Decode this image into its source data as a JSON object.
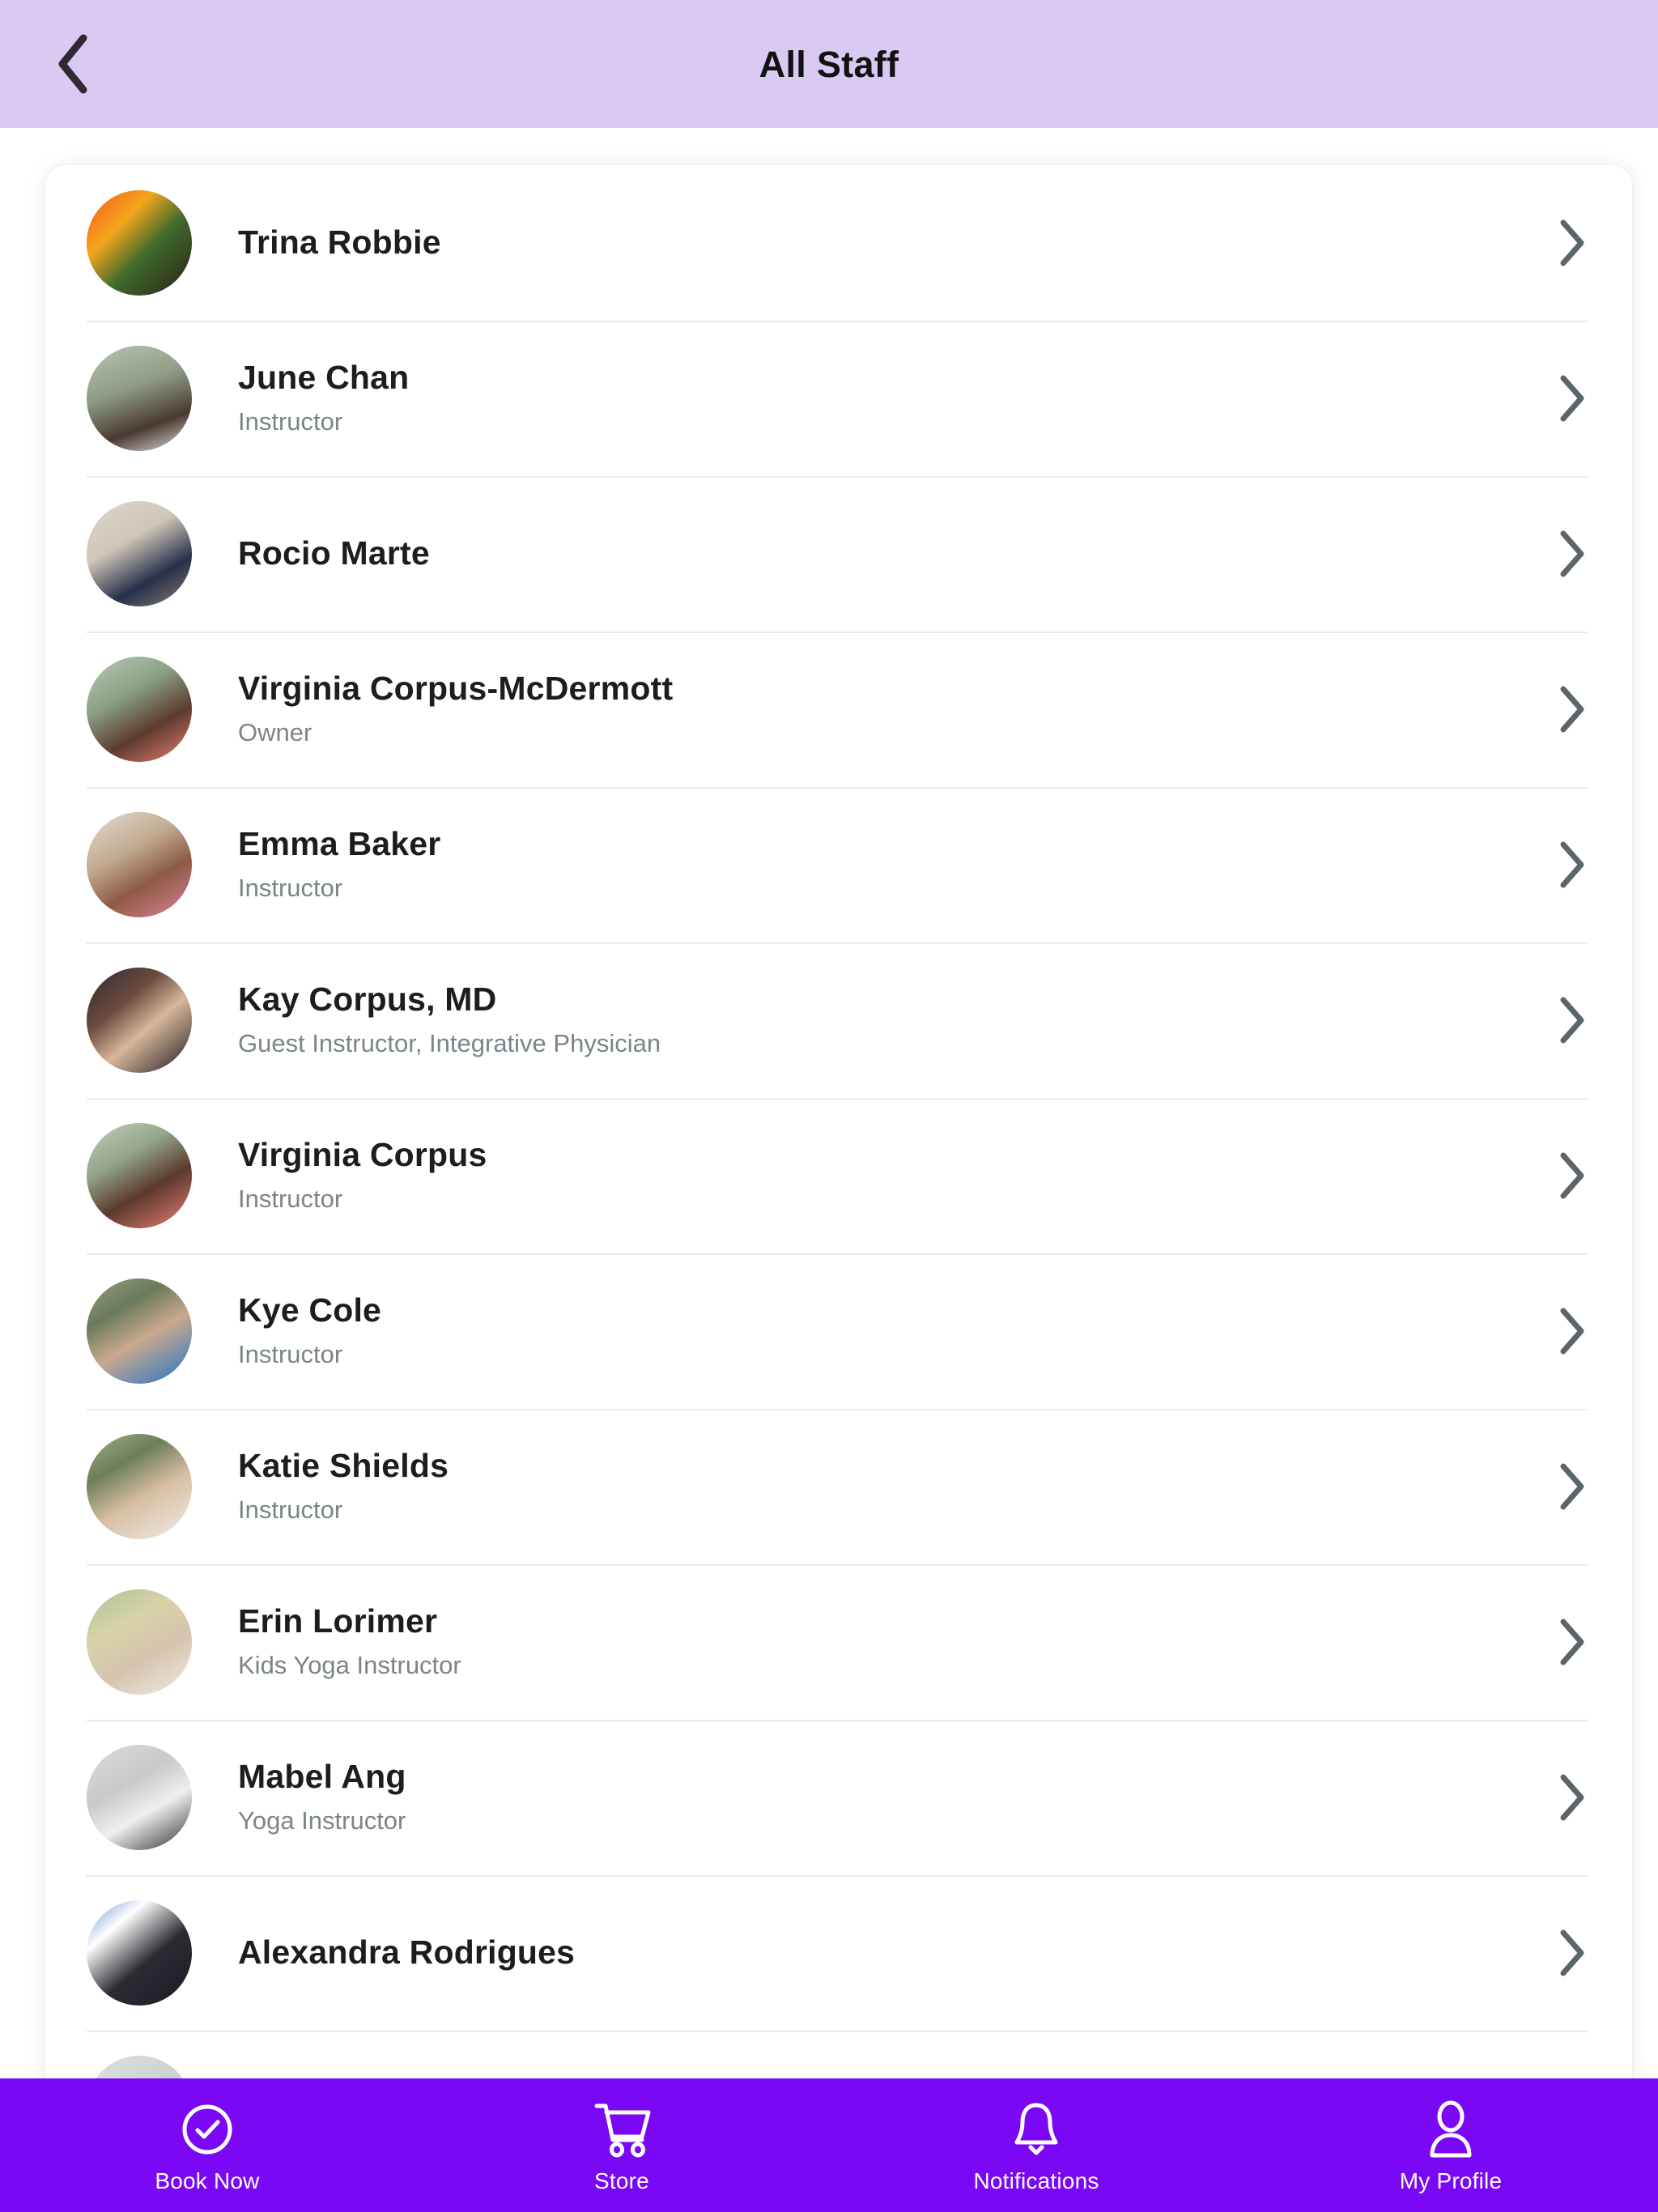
{
  "header": {
    "title": "All Staff",
    "back_icon": "chevron-left-icon",
    "background_color": "#dac9f2"
  },
  "staff_list": {
    "row_chevron_icon": "chevron-right-icon",
    "rows": [
      {
        "name": "Trina Robbie",
        "title": "",
        "avatar": "photo-trina-robbie"
      },
      {
        "name": "June Chan",
        "title": "Instructor",
        "avatar": "photo-june-chan"
      },
      {
        "name": "Rocio Marte",
        "title": "",
        "avatar": "photo-rocio-marte"
      },
      {
        "name": "Virginia Corpus-McDermott",
        "title": "Owner",
        "avatar": "photo-virginia-corpus-mcdermott"
      },
      {
        "name": "Emma Baker",
        "title": "Instructor",
        "avatar": "photo-emma-baker"
      },
      {
        "name": "Kay Corpus, MD",
        "title": "Guest Instructor, Integrative Physician",
        "avatar": "photo-kay-corpus"
      },
      {
        "name": "Virginia Corpus",
        "title": "Instructor",
        "avatar": "photo-virginia-corpus"
      },
      {
        "name": "Kye Cole",
        "title": "Instructor",
        "avatar": "photo-kye-cole"
      },
      {
        "name": "Katie Shields",
        "title": "Instructor",
        "avatar": "photo-katie-shields"
      },
      {
        "name": "Erin Lorimer",
        "title": "Kids Yoga Instructor",
        "avatar": "photo-erin-lorimer"
      },
      {
        "name": "Mabel Ang",
        "title": "Yoga Instructor",
        "avatar": "photo-mabel-ang"
      },
      {
        "name": "Alexandra Rodrigues",
        "title": "",
        "avatar": "photo-alexandra-rodrigues"
      },
      {
        "name": "",
        "title": "",
        "avatar": "photo-partial-row"
      }
    ]
  },
  "bottom_nav": {
    "background_color": "#7a08f5",
    "items": [
      {
        "label": "Book Now",
        "icon": "check-circle-icon"
      },
      {
        "label": "Store",
        "icon": "shopping-cart-icon"
      },
      {
        "label": "Notifications",
        "icon": "bell-icon"
      },
      {
        "label": "My Profile",
        "icon": "user-icon"
      }
    ]
  }
}
